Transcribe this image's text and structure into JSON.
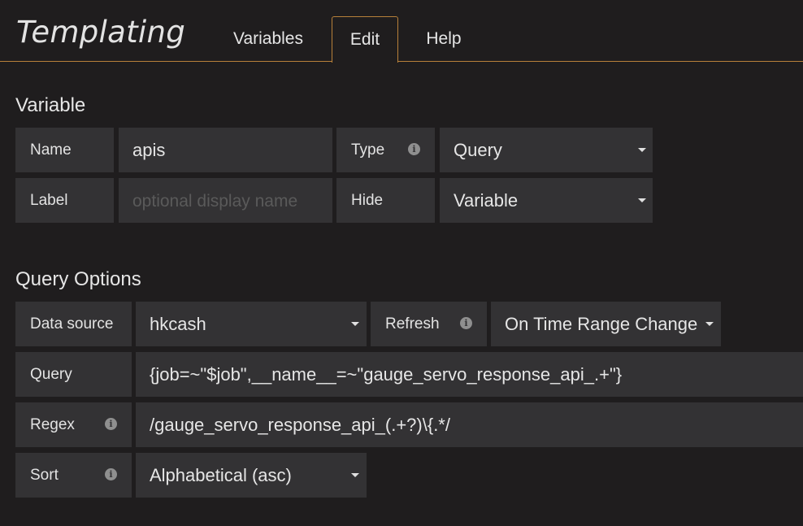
{
  "header": {
    "title": "Templating",
    "tabs": [
      {
        "label": "Variables"
      },
      {
        "label": "Edit"
      },
      {
        "label": "Help"
      }
    ]
  },
  "variable": {
    "section_title": "Variable",
    "name_label": "Name",
    "name_value": "apis",
    "type_label": "Type",
    "type_value": "Query",
    "label_label": "Label",
    "label_placeholder": "optional display name",
    "hide_label": "Hide",
    "hide_value": "Variable"
  },
  "query_options": {
    "section_title": "Query Options",
    "datasource_label": "Data source",
    "datasource_value": "hkcash",
    "refresh_label": "Refresh",
    "refresh_value": "On Time Range Change",
    "query_label": "Query",
    "query_value": "{job=~\"$job\",__name__=~\"gauge_servo_response_api_.+\"}",
    "regex_label": "Regex",
    "regex_value": "/gauge_servo_response_api_(.+?)\\{.*/",
    "sort_label": "Sort",
    "sort_value": "Alphabetical (asc)"
  },
  "icons": {
    "info": "info-icon",
    "caret": "caret-down-icon"
  }
}
